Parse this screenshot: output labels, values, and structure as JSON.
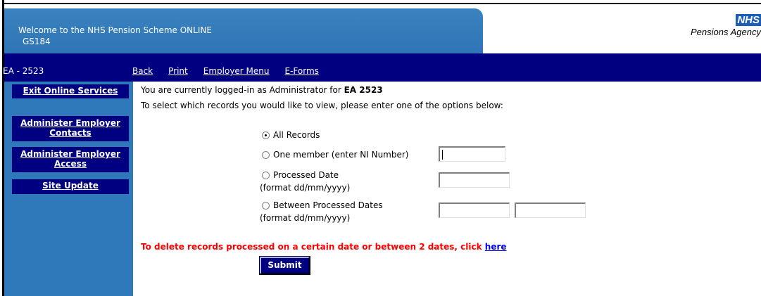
{
  "header": {
    "title": "Welcome to the NHS Pension Scheme ONLINE",
    "code": "GS184",
    "logo_nhs": "NHS",
    "logo_agency": "Pensions Agency"
  },
  "navbar": {
    "employer_code": "EA - 2523",
    "links": [
      "Back",
      "Print",
      "Employer Menu",
      "E-Forms"
    ]
  },
  "sidebar": {
    "items": [
      {
        "label": "Exit Online Services"
      },
      {
        "label": "Administer Employer Contacts"
      },
      {
        "label": "Administer Employer Access"
      },
      {
        "label": "Site Update"
      }
    ]
  },
  "main": {
    "login_prefix": "You are currently logged-in as Administrator for ",
    "login_employer": "EA 2523",
    "instruction": "To select which records you would like to view, please enter one of the options below:",
    "options": [
      {
        "label": "All Records",
        "checked": true
      },
      {
        "label": "One member (enter NI Number)",
        "checked": false
      },
      {
        "label": "Processed Date",
        "sub": "(format dd/mm/yyyy)",
        "checked": false
      },
      {
        "label": "Between Processed Dates",
        "sub": "(format dd/mm/yyyy)",
        "checked": false
      }
    ],
    "ni_number_value": "",
    "processed_date_value": "",
    "from_date_value": "",
    "to_date_value": "",
    "delete_text": "To delete records processed on a certain date or between 2 dates, click ",
    "delete_link": "here",
    "submit_label": "Submit"
  }
}
